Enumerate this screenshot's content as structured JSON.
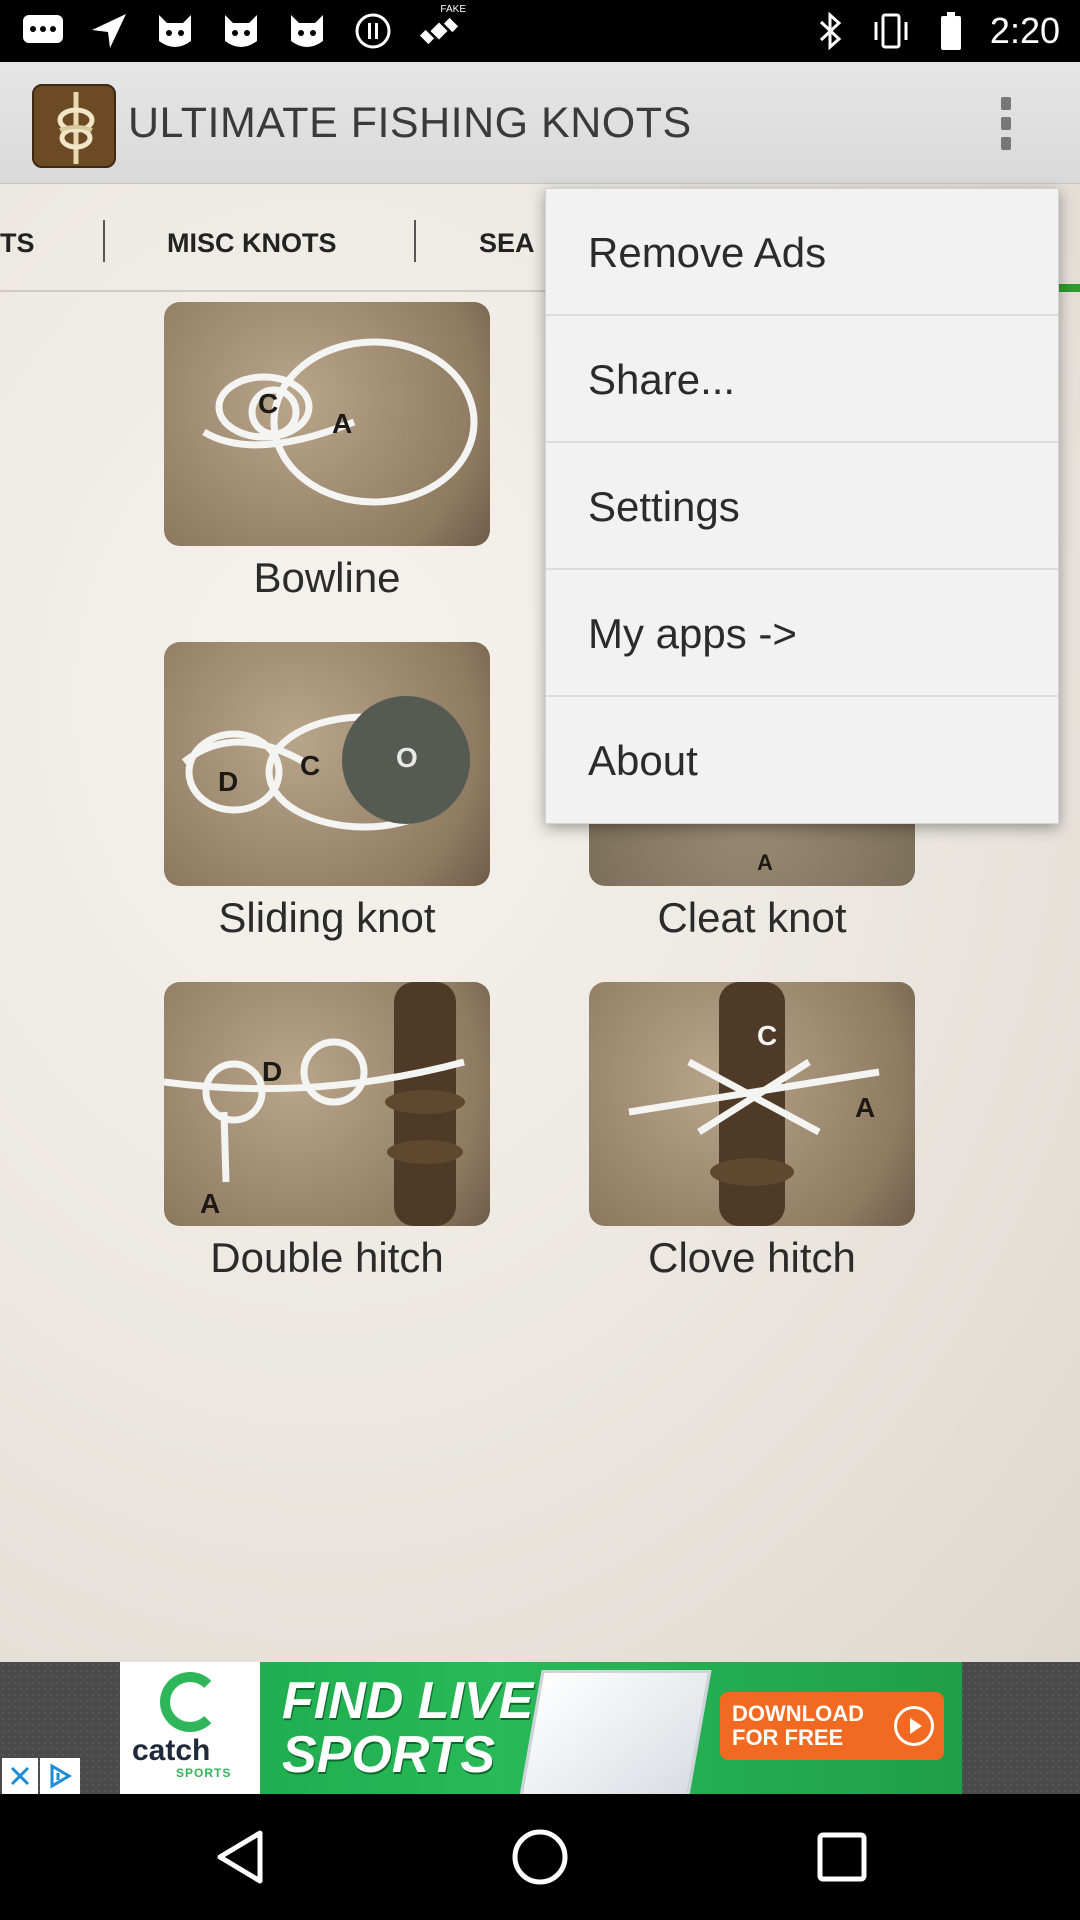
{
  "status_bar": {
    "time": "2:20",
    "left_icons": [
      "message-icon",
      "navigation-icon",
      "cat-face-icon",
      "cat-face-icon",
      "cat-face-icon",
      "pause-circle-icon",
      "satellite-icon"
    ],
    "right_icons": [
      "bluetooth-icon",
      "vibrate-icon",
      "battery-icon"
    ],
    "satellite_badge": "FAKE"
  },
  "action_bar": {
    "title": "ULTIMATE FISHING KNOTS",
    "logo_icon": "knot-logo-icon",
    "overflow_icon": "more-vert-icon"
  },
  "tabs": [
    {
      "label": "TS"
    },
    {
      "label": "MISC KNOTS"
    },
    {
      "label": "SEA"
    }
  ],
  "knots": [
    {
      "name": "Bowline",
      "letters": [
        "C",
        "A"
      ]
    },
    {
      "name": "Sliding knot",
      "letters": [
        "D",
        "C",
        "O"
      ]
    },
    {
      "name": "Cleat knot",
      "letters": [
        "A"
      ]
    },
    {
      "name": "Double hitch",
      "letters": [
        "D",
        "A"
      ]
    },
    {
      "name": "Clove hitch",
      "letters": [
        "C",
        "A"
      ]
    }
  ],
  "menu": {
    "items": [
      {
        "label": "Remove Ads"
      },
      {
        "label": "Share..."
      },
      {
        "label": "Settings"
      },
      {
        "label": "My apps ->"
      },
      {
        "label": "About"
      }
    ]
  },
  "ad": {
    "brand": "catch",
    "brand_sub": "SPORTS",
    "headline_1": "FIND LIVE",
    "headline_2": "SPORTS",
    "cta_1": "DOWNLOAD",
    "cta_2": "FOR FREE",
    "close_icon": "close-icon",
    "info_icon": "ad-choices-icon",
    "accent_color": "#1aa84b",
    "cta_color": "#f26a21"
  },
  "nav_bar": {
    "buttons": [
      "back-icon",
      "home-icon",
      "recents-icon"
    ]
  },
  "colors": {
    "tab_indicator": "#2f9b2f",
    "menu_background": "#f2f2f2"
  }
}
